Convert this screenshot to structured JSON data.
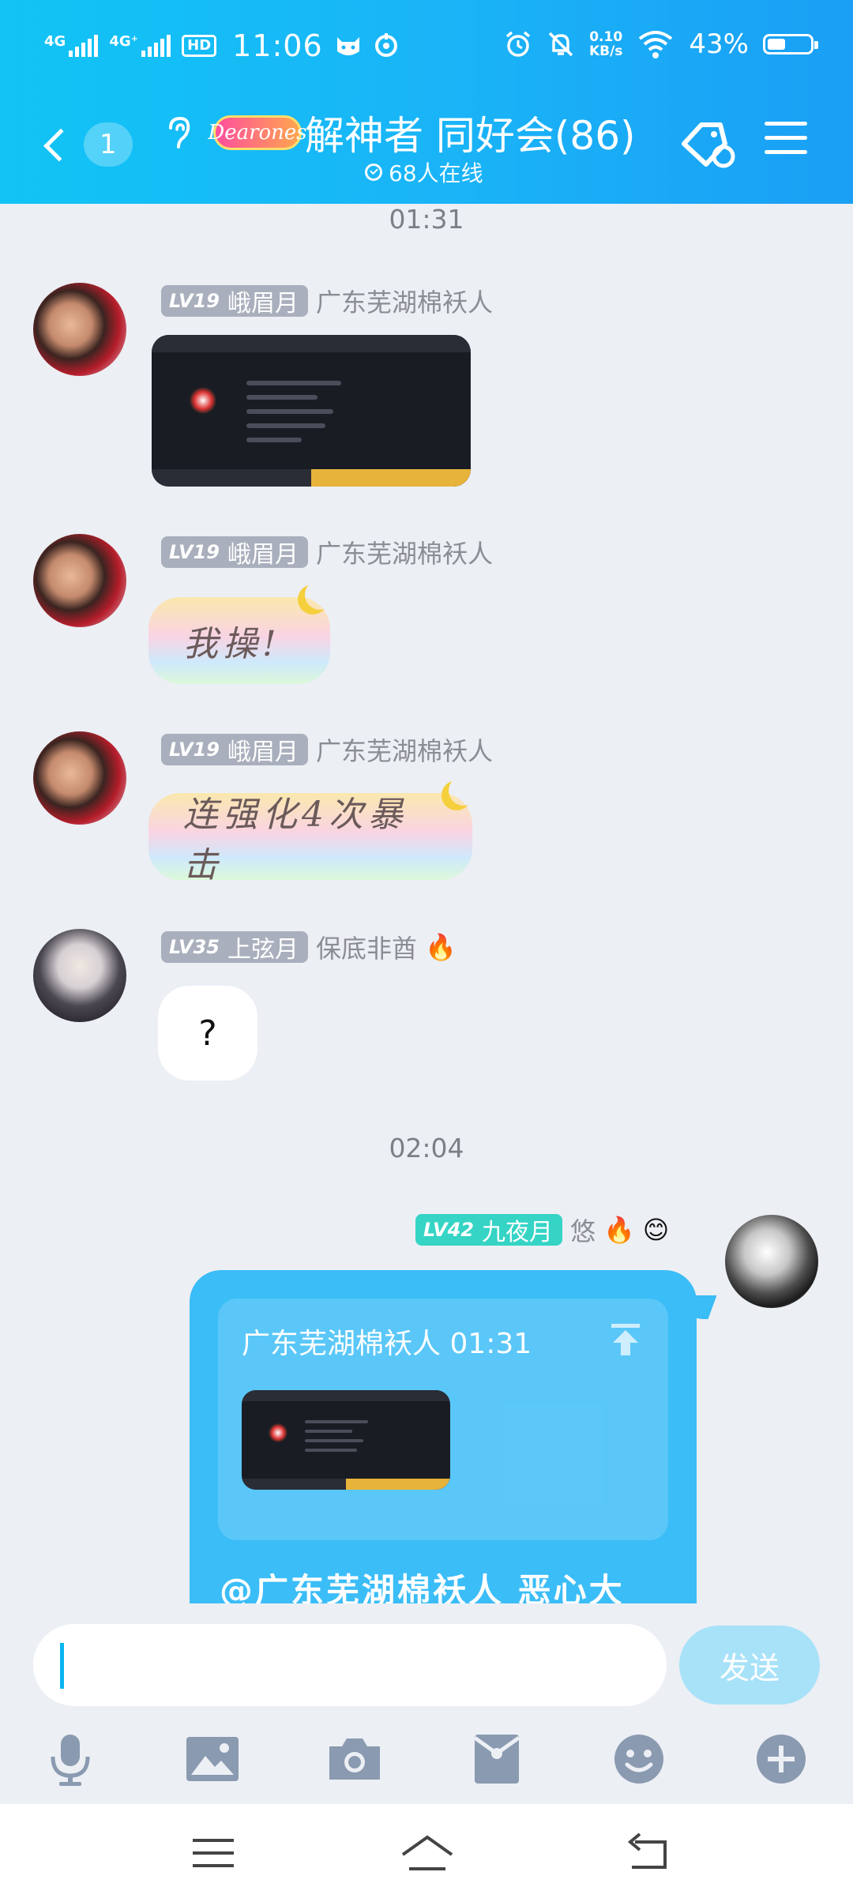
{
  "status_bar": {
    "network1": "4G",
    "network2": "4G⁺",
    "hd": "HD",
    "time": "11:06",
    "speed_value": "0.10",
    "speed_unit": "KB/s",
    "battery_percent": "43%",
    "battery_level": 0.43
  },
  "header": {
    "unread_count": "1",
    "group_logo_text": "Dearones",
    "group_name": "解神者 同好会(86)",
    "online_text": "68人在线"
  },
  "chat": {
    "time1": "01:31",
    "time2": "02:04",
    "messages": [
      {
        "level": "LV19",
        "title": "峨眉月",
        "sender": "广东芜湖棉袄人"
      },
      {
        "level": "LV19",
        "title": "峨眉月",
        "sender": "广东芜湖棉袄人",
        "text": "我操!"
      },
      {
        "level": "LV19",
        "title": "峨眉月",
        "sender": "广东芜湖棉袄人",
        "text": "连强化4次暴击"
      },
      {
        "level": "LV35",
        "title": "上弦月",
        "sender": "保底非酋",
        "text": "?"
      },
      {
        "level": "LV42",
        "title": "九夜月",
        "sender": "悠"
      }
    ],
    "reply": {
      "quote_header": "广东芜湖棉袄人 01:31",
      "text": "@广东芜湖棉袄人 恶心大"
    }
  },
  "input": {
    "send_label": "发送"
  },
  "colors": {
    "header_accent": "#1ab3f7",
    "my_bubble": "#3bbdf7",
    "send_button": "#a8e2f9"
  }
}
